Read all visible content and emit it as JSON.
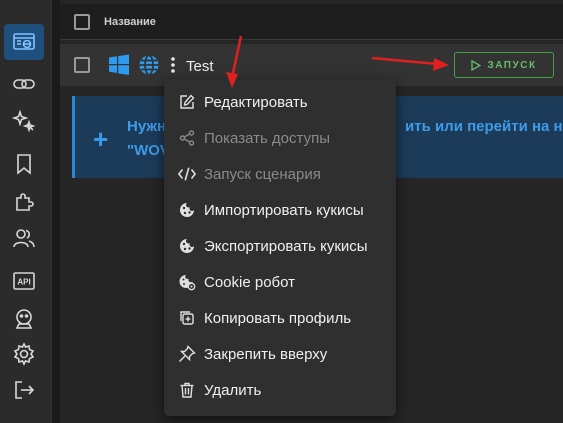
{
  "header": {
    "select_all_label": "Название"
  },
  "profile": {
    "name": "Test",
    "run_label": "ЗАПУСК"
  },
  "notice": {
    "line1": "Нужн",
    "line1_right": "ить или перейти на нов",
    "line2": "\"WOV"
  },
  "menu": {
    "items": [
      {
        "label": "Редактировать",
        "icon": "edit-icon",
        "disabled": false
      },
      {
        "label": "Показать доступы",
        "icon": "share-icon",
        "disabled": true
      },
      {
        "label": "Запуск сценария",
        "icon": "code-icon",
        "disabled": true
      },
      {
        "label": "Импортировать кукисы",
        "icon": "cookie-icon",
        "disabled": false
      },
      {
        "label": "Экспортировать кукисы",
        "icon": "cookie-icon",
        "disabled": false
      },
      {
        "label": "Cookie робот",
        "icon": "cookie-robot-icon",
        "disabled": false
      },
      {
        "label": "Копировать профиль",
        "icon": "copy-icon",
        "disabled": false
      },
      {
        "label": "Закрепить вверху",
        "icon": "pin-icon",
        "disabled": false
      },
      {
        "label": "Удалить",
        "icon": "trash-icon",
        "disabled": false
      }
    ]
  },
  "sidebar": {
    "items": [
      {
        "icon": "browser-profiles-icon",
        "active": true
      },
      {
        "icon": "link-icon",
        "active": false
      },
      {
        "icon": "sparkles-icon",
        "active": false
      },
      {
        "icon": "bookmark-icon",
        "active": false
      },
      {
        "icon": "puzzle-icon",
        "active": false
      },
      {
        "icon": "users-icon",
        "active": false
      },
      {
        "icon": "api-icon",
        "active": false
      },
      {
        "icon": "robot-icon",
        "active": false
      },
      {
        "icon": "settings-icon",
        "active": false
      },
      {
        "icon": "logout-icon",
        "active": false
      }
    ],
    "api_text": "API"
  },
  "colors": {
    "accent": "#2d86d8",
    "run_green": "#43a047",
    "arrow_red": "#e02020"
  }
}
